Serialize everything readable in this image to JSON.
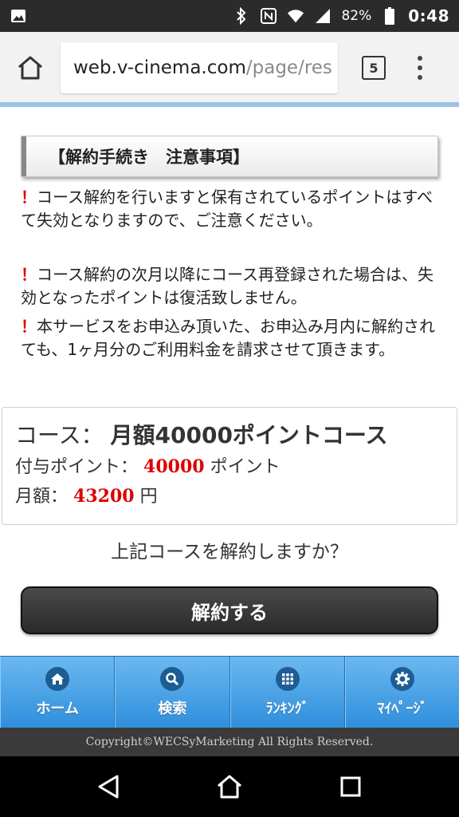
{
  "status_bar": {
    "battery_percent": "82%",
    "time": "0:48",
    "icons": [
      "image-icon",
      "bluetooth-icon",
      "nfc-icon",
      "wifi-icon",
      "signal-icon",
      "battery-icon"
    ]
  },
  "browser": {
    "url_host": "web.v-cinema.com",
    "url_path": "/page/res",
    "tab_count": "5"
  },
  "notice": {
    "heading": "【解約手続き　注意事項】",
    "bang": "！",
    "items": [
      "コース解約を行いますと保有されているポイントはすべて失効となりますので、ご注意ください。",
      "コース解約の次月以降にコース再登録された場合は、失効となったポイントは復活致しません。",
      "本サービスをお申込み頂いた、お申込み月内に解約されても、1ヶ月分のご利用料金を請求させて頂きます。"
    ]
  },
  "course": {
    "course_label": "コース：",
    "course_name": "月額40000ポイントコース",
    "points_label": "付与ポイント：",
    "points_value": "40000",
    "points_unit": "ポイント",
    "price_label": "月額：",
    "price_value": "43200",
    "price_unit": "円"
  },
  "question": "上記コースを解約しますか？",
  "cancel_button": "解約する",
  "bottom_nav": [
    {
      "label": "ホーム",
      "icon": "home-icon"
    },
    {
      "label": "検索",
      "icon": "search-icon"
    },
    {
      "label": "ﾗﾝｷﾝｸﾞ",
      "icon": "ranking-icon"
    },
    {
      "label": "ﾏｲﾍﾟｰｼﾞ",
      "icon": "gear-icon"
    }
  ],
  "copyright": "Copyright©WECSyMarketing All Rights Reserved.",
  "colors": {
    "accent_blue": "#2f8fdc",
    "warning_red": "#e00000",
    "button_dark": "#2a2a2a"
  }
}
